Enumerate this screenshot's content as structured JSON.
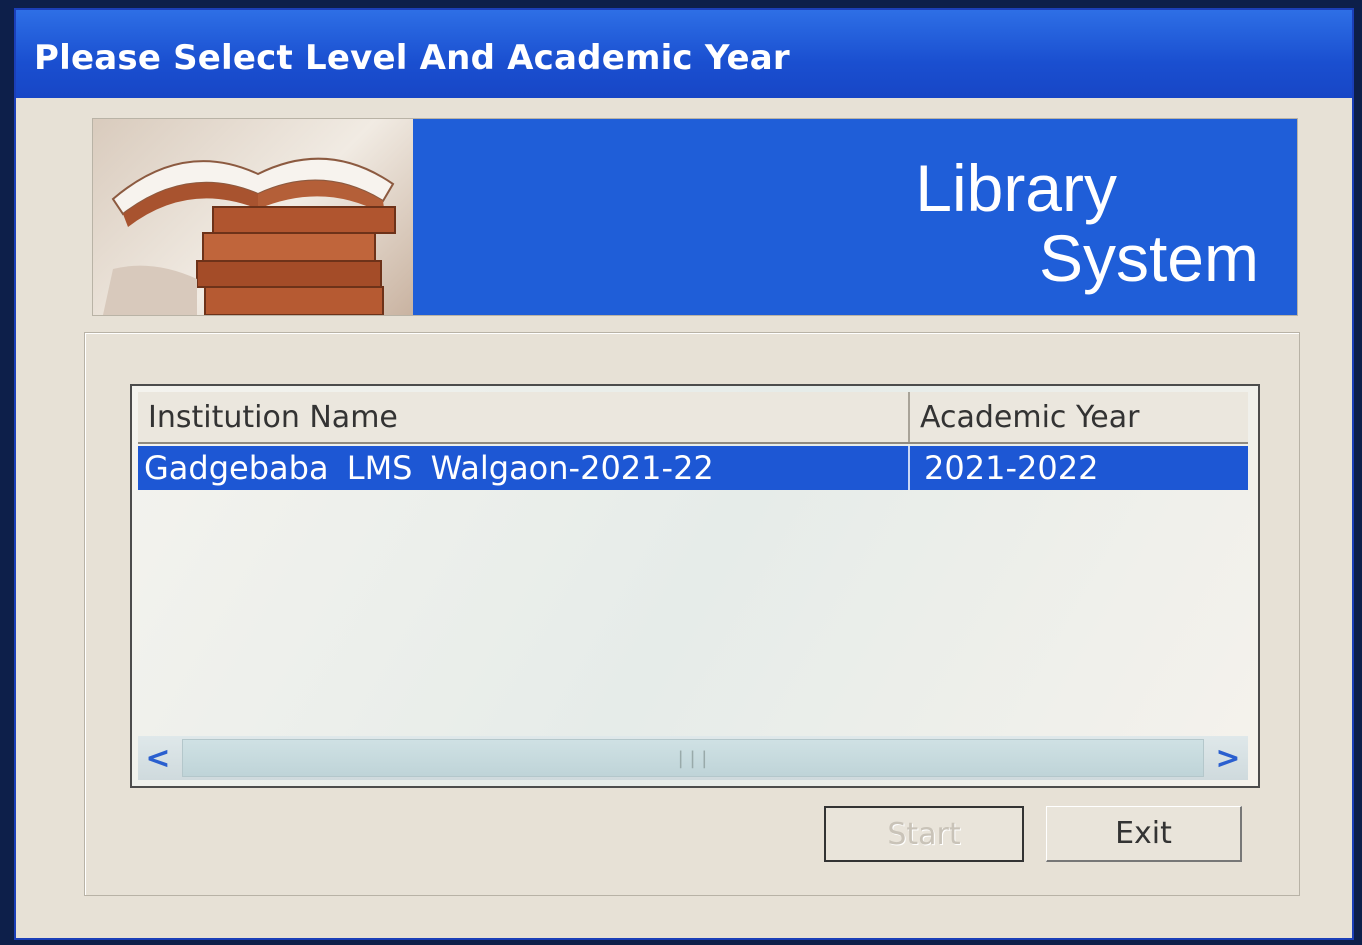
{
  "window": {
    "title": "Please Select Level And Academic Year"
  },
  "banner": {
    "line1": "Library",
    "line2": "System",
    "image_icon": "books-icon"
  },
  "list": {
    "columns": [
      "Institution Name",
      "Academic Year"
    ],
    "rows": [
      {
        "institution": "Gadgebaba LMS Walgaon-2021-22",
        "year": "2021-2022",
        "selected": true
      }
    ]
  },
  "scrollbar": {
    "left_icon": "chevron-left-icon",
    "right_icon": "chevron-right-icon",
    "left_glyph": "<",
    "right_glyph": ">",
    "grip": "|||"
  },
  "buttons": {
    "start_label": "Start",
    "exit_label": "Exit",
    "start_enabled": false
  },
  "colors": {
    "titlebar": "#1a4fd0",
    "banner": "#1f5ed8",
    "selection": "#1d57d4"
  }
}
